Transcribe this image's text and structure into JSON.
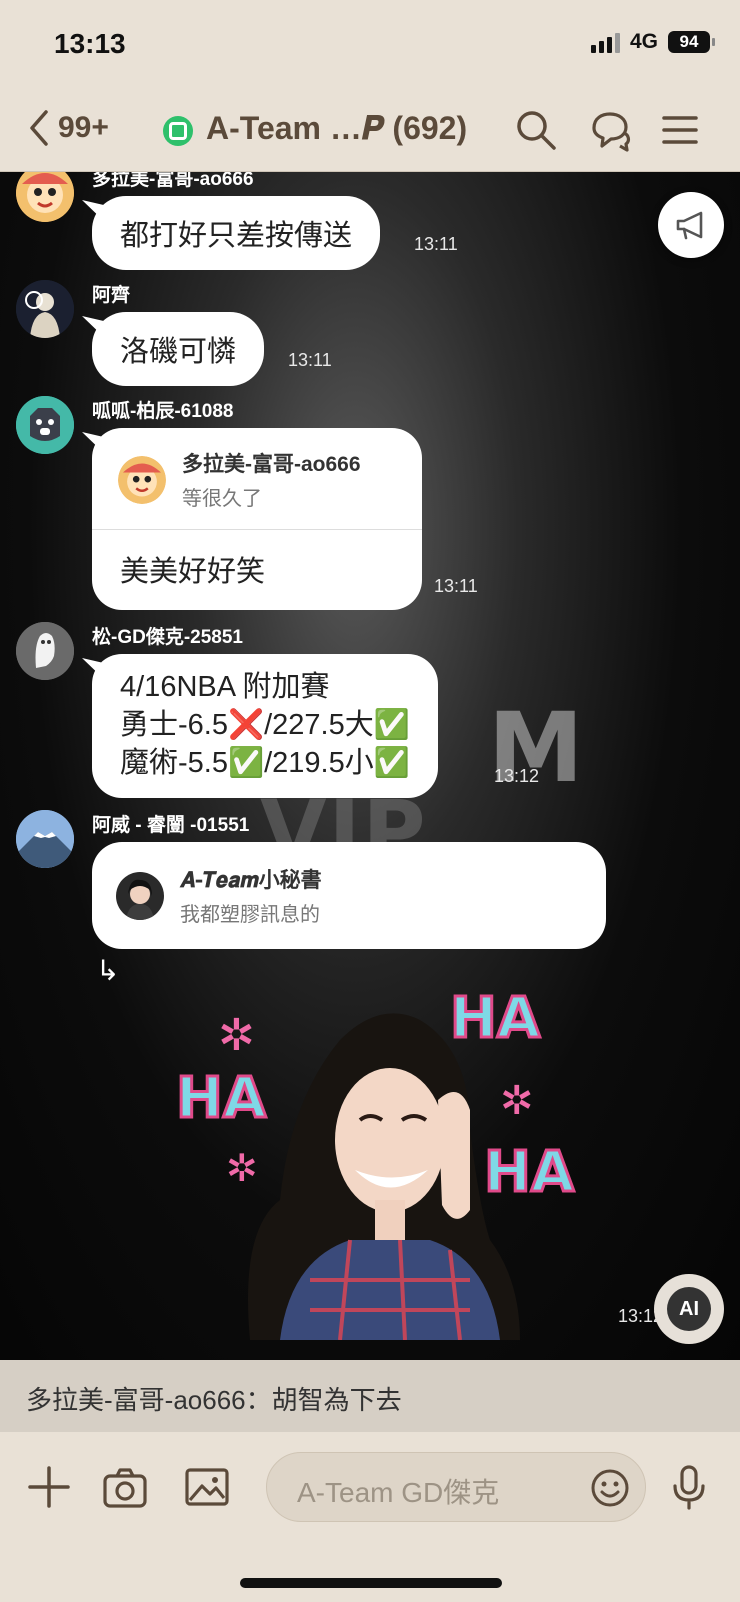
{
  "status": {
    "time": "13:13",
    "network": "4G",
    "battery": "94"
  },
  "header": {
    "back_count": "99+",
    "title": "A-Team …𝑷 (692)"
  },
  "watermark": {
    "line1": "M",
    "line2": "VIP"
  },
  "messages": [
    {
      "sender": "多拉美-富哥-ao666",
      "text": "都打好只差按傳送",
      "time": "13:11"
    },
    {
      "sender": "阿齊",
      "text": "洛磯可憐",
      "time": "13:11"
    },
    {
      "sender": "呱呱-柏辰-61088",
      "reply_name": "多拉美-富哥-ao666",
      "reply_text": "等很久了",
      "text": "美美好好笑",
      "time": "13:11"
    },
    {
      "sender": "松-GD傑克-25851",
      "lines": [
        "4/16NBA 附加賽",
        "勇士-6.5❌/227.5大✅",
        "魔術-5.5✅/219.5小✅"
      ],
      "time": "13:12"
    },
    {
      "sender": "阿威 - 睿闓 -01551",
      "reply_name": "𝑨-𝑻𝒆𝒂𝒎小秘書",
      "reply_text": "我都塑膠訊息的",
      "sticker_text": [
        "HA",
        "HA",
        "HA"
      ],
      "time": "13:12"
    }
  ],
  "preview": {
    "text": "多拉美-富哥-ao666：胡智為下去"
  },
  "input": {
    "placeholder": "A-Team GD傑克"
  },
  "ai_label": "AI",
  "reply_arrow": "↳"
}
